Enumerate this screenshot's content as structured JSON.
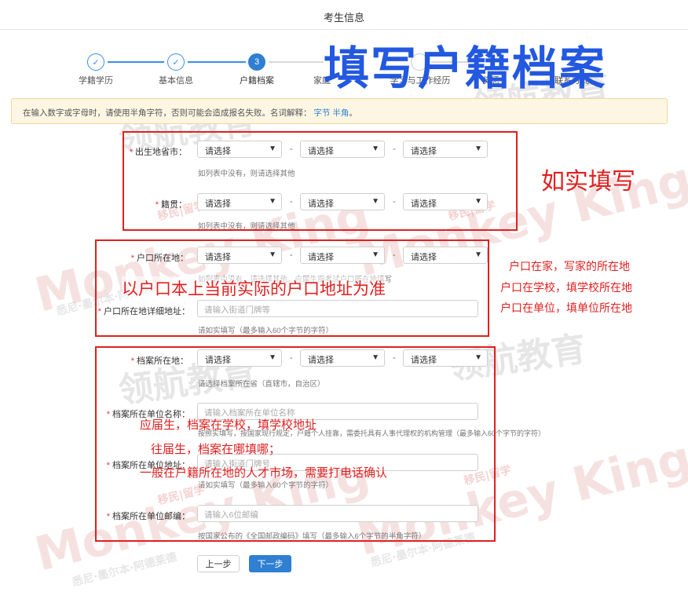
{
  "header": {
    "title": "考生信息"
  },
  "steps": [
    {
      "label": "学籍学历",
      "state": "done",
      "mark": "✓"
    },
    {
      "label": "基本信息",
      "state": "done",
      "mark": "✓"
    },
    {
      "label": "户籍档案",
      "state": "active",
      "mark": "3"
    },
    {
      "label": "家庭",
      "state": "todo",
      "mark": ""
    },
    {
      "label": "学习与工作经历",
      "state": "todo",
      "mark": ""
    },
    {
      "label": "奖惩",
      "state": "todo",
      "mark": ""
    },
    {
      "label": "联系方式",
      "state": "todo",
      "mark": ""
    }
  ],
  "notice": {
    "text": "在输入数字或字母时，请使用半角字符，否则可能会造成报名失败。名词解释：",
    "link1": "字节",
    "link2": "半角",
    "end": "。"
  },
  "form": {
    "select_placeholder": "请选择",
    "dash": "-",
    "birthplace": {
      "label": "出生地省市：",
      "hint": "如列表中没有，则请选择其他"
    },
    "native_place": {
      "label": "籍贯：",
      "hint": "如列表中没有，则请选择其他"
    },
    "hukou": {
      "label": "户口所在地：",
      "hint": "如列表中没有，请选择其他。应届生指考试户口所在地填写"
    },
    "hukou_detail": {
      "label": "户口所在地详细地址：",
      "placeholder": "请输入街道门牌等",
      "hint": "请如实填写（最多输入60个字节的字符）"
    },
    "archive": {
      "label": "档案所在地：",
      "hint": "请选择档案所在省（直辖市，自治区）"
    },
    "archive_org": {
      "label": "档案所在单位名称：",
      "placeholder": "请输入档案所在单位名称",
      "hint": "按照实填写，按国家现行规定，户籍个人挂靠，需委托具有人事代理权的机构管理（最多输入60个字节的字符）"
    },
    "archive_addr": {
      "label": "档案所在单位地址：",
      "placeholder": "请输入街道门牌号",
      "hint": "请如实填写（最多输入60个字节的字符）"
    },
    "archive_zip": {
      "label": "档案所在单位邮编：",
      "placeholder": "请输入6位邮编",
      "hint": "按国家公布的《全国邮政编码》填写（最多输入6个字节的半角字符）"
    }
  },
  "buttons": {
    "prev": "上一步",
    "next": "下一步"
  },
  "annotations": {
    "title": "填写户籍档案",
    "note1": "如实填写",
    "note2": "以户口本上当前实际的户口地址为准",
    "note3": [
      "户口在家，写家的所在地",
      "户口在学校，填学校所在地",
      "户口在单位，填单位所在地"
    ],
    "note4": [
      "应届生，档案在学校，填学校地址",
      "往届生，档案在哪填哪；",
      "一般在户籍所在地的人才市场，需要打电话确认"
    ]
  },
  "watermarks": {
    "cn": "领航教育",
    "en": "Monkey King",
    "tag": "移民|留学",
    "sub": "悉尼·墨尔本·阿德莱德"
  },
  "colors": {
    "accent": "#2f7fd3",
    "annotation_red": "#e02020",
    "annotation_blue": "#2358e0"
  }
}
